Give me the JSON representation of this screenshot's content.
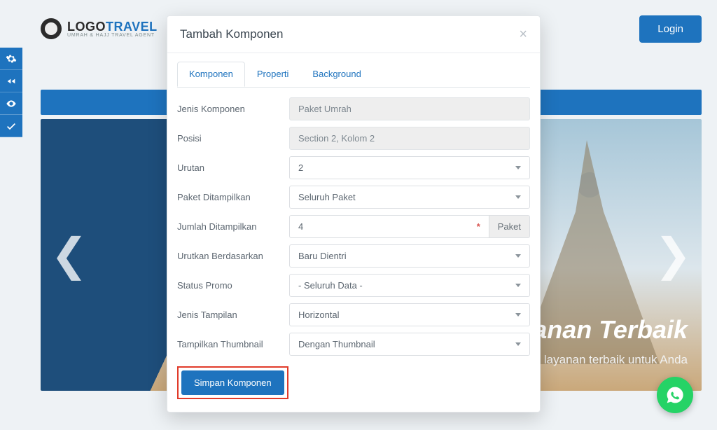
{
  "header": {
    "logo_main_dark": "LOGO",
    "logo_main_accent": "TRAVEL",
    "logo_sub": "UMRAH & HAJJ TRAVEL AGENT",
    "login_label": "Login"
  },
  "hero": {
    "caption_main": "ayanan Terbaik",
    "caption_sub": "Garansi harga & layanan terbaik untuk Anda"
  },
  "modal": {
    "title": "Tambah Komponen",
    "tabs": [
      "Komponen",
      "Properti",
      "Background"
    ],
    "active_tab": 0,
    "fields": {
      "jenis_komponen": {
        "label": "Jenis Komponen",
        "value": "Paket Umrah"
      },
      "posisi": {
        "label": "Posisi",
        "value": "Section 2, Kolom 2"
      },
      "urutan": {
        "label": "Urutan",
        "value": "2"
      },
      "paket": {
        "label": "Paket Ditampilkan",
        "value": "Seluruh Paket"
      },
      "jumlah": {
        "label": "Jumlah Ditampilkan",
        "value": "4",
        "addon": "Paket"
      },
      "urutkan": {
        "label": "Urutkan Berdasarkan",
        "value": "Baru Dientri"
      },
      "status": {
        "label": "Status Promo",
        "value": "- Seluruh Data -"
      },
      "tampilan": {
        "label": "Jenis Tampilan",
        "value": "Horizontal"
      },
      "thumb": {
        "label": "Tampilkan Thumbnail",
        "value": "Dengan Thumbnail"
      }
    },
    "submit_label": "Simpan Komponen"
  }
}
